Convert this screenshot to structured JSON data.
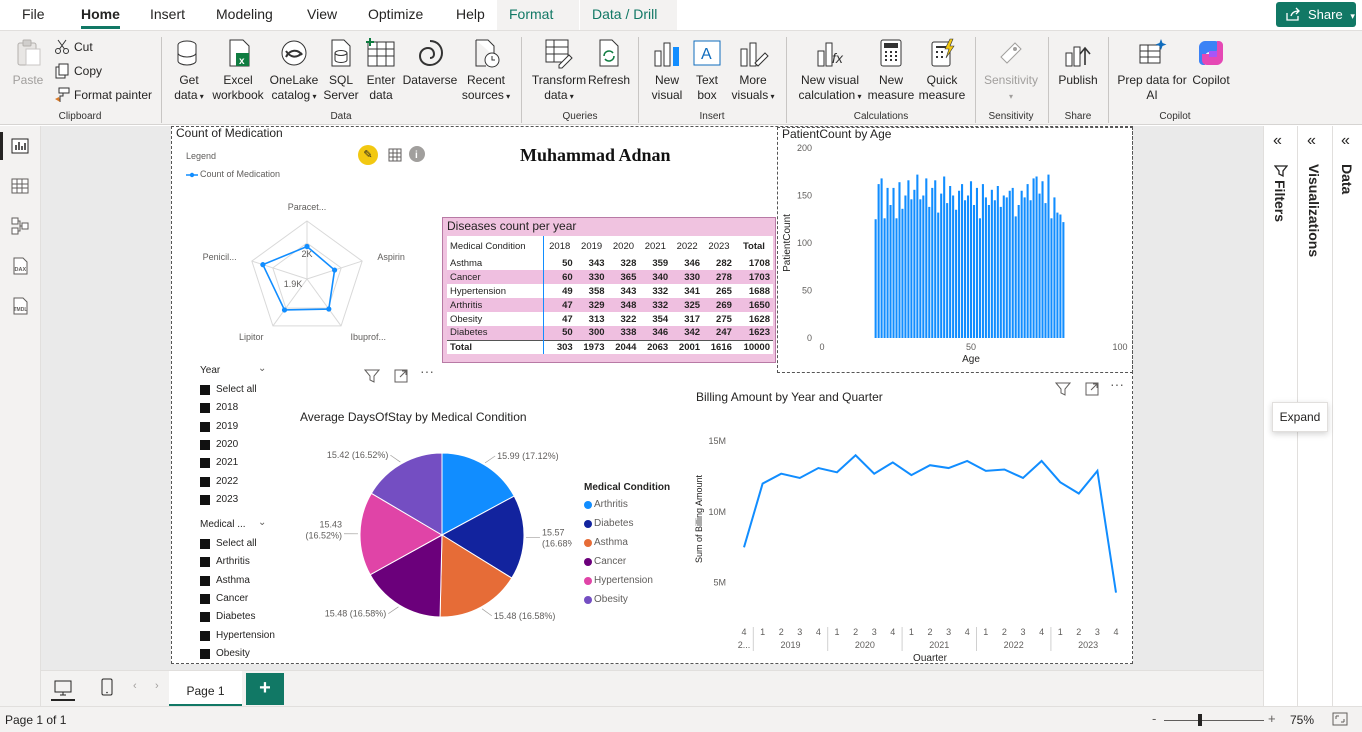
{
  "menu": {
    "tabs": [
      "File",
      "Home",
      "Insert",
      "Modeling",
      "View",
      "Optimize",
      "Help",
      "Format",
      "Data / Drill"
    ],
    "active": "Home",
    "share": "Share"
  },
  "ribbon": {
    "clipboard": {
      "paste": "Paste",
      "cut": "Cut",
      "copy": "Copy",
      "format_painter": "Format painter",
      "label": "Clipboard"
    },
    "data": {
      "get_data": [
        "Get",
        "data"
      ],
      "excel": [
        "Excel",
        "workbook"
      ],
      "onelake": [
        "OneLake",
        "catalog"
      ],
      "sql": [
        "SQL",
        "Server"
      ],
      "enter": [
        "Enter",
        "data"
      ],
      "dataverse": "Dataverse",
      "recent": [
        "Recent",
        "sources"
      ],
      "label": "Data"
    },
    "queries": {
      "transform": [
        "Transform",
        "data"
      ],
      "refresh": "Refresh",
      "label": "Queries"
    },
    "insert": {
      "new_visual": [
        "New",
        "visual"
      ],
      "text_box": [
        "Text",
        "box"
      ],
      "more_visuals": [
        "More",
        "visuals"
      ],
      "label": "Insert"
    },
    "calculations": {
      "visual_calc": [
        "New visual",
        "calculation"
      ],
      "new_measure": [
        "New",
        "measure"
      ],
      "quick_measure": [
        "Quick",
        "measure"
      ],
      "label": "Calculations"
    },
    "sensitivity": {
      "btn": "Sensitivity",
      "label": "Sensitivity"
    },
    "share": {
      "publish": "Publish",
      "label": "Share"
    },
    "copilot": {
      "prep": [
        "Prep data for",
        "AI"
      ],
      "copilot": "Copilot",
      "label": "Copilot"
    }
  },
  "report": {
    "title_text": "Muhammad Adnan",
    "radar": {
      "title": "Count of Medication",
      "legend_title": "Legend",
      "legend_item": "Count of Medication",
      "axes": [
        "Paracet...",
        "Aspirin",
        "Ibuprof...",
        "Lipitor",
        "Penicil..."
      ],
      "ring_labels": [
        "2K",
        "1.9K"
      ],
      "accent": "#118DFF"
    },
    "table": {
      "title": "Diseases count per year",
      "headers": [
        "Medical Condition",
        "2018",
        "2019",
        "2020",
        "2021",
        "2022",
        "2023",
        "Total"
      ],
      "rows": [
        [
          "Asthma",
          "50",
          "343",
          "328",
          "359",
          "346",
          "282",
          "1708"
        ],
        [
          "Cancer",
          "60",
          "330",
          "365",
          "340",
          "330",
          "278",
          "1703"
        ],
        [
          "Hypertension",
          "49",
          "358",
          "343",
          "332",
          "341",
          "265",
          "1688"
        ],
        [
          "Arthritis",
          "47",
          "329",
          "348",
          "332",
          "325",
          "269",
          "1650"
        ],
        [
          "Obesity",
          "47",
          "313",
          "322",
          "354",
          "317",
          "275",
          "1628"
        ],
        [
          "Diabetes",
          "50",
          "300",
          "338",
          "346",
          "342",
          "247",
          "1623"
        ]
      ],
      "total": [
        "Total",
        "303",
        "1973",
        "2044",
        "2063",
        "2001",
        "1616",
        "10000"
      ]
    },
    "slicer_year": {
      "title": "Year",
      "items": [
        "Select all",
        "2018",
        "2019",
        "2020",
        "2021",
        "2022",
        "2023"
      ]
    },
    "slicer_condition": {
      "title": "Medical ...",
      "items": [
        "Select all",
        "Arthritis",
        "Asthma",
        "Cancer",
        "Diabetes",
        "Hypertension",
        "Obesity"
      ]
    },
    "pie_title": "Average DaysOfStay by Medical Condition",
    "pie_legend_title": "Medical Condition",
    "billing_title": "Billing Amount by Year and Quarter",
    "patient_title": "PatientCount by Age",
    "expand_tooltip": "Expand"
  },
  "chart_data": [
    {
      "type": "radar",
      "title": "Count of Medication",
      "categories": [
        "Paracet...",
        "Aspirin",
        "Ibuprof...",
        "Lipitor",
        "Penicil..."
      ],
      "values": [
        1990,
        1975,
        2010,
        2015,
        2050
      ]
    },
    {
      "type": "pie",
      "title": "Average DaysOfStay by Medical Condition",
      "categories": [
        "Arthritis",
        "Diabetes",
        "Asthma",
        "Cancer",
        "Hypertension",
        "Obesity"
      ],
      "values": [
        15.99,
        15.57,
        15.48,
        15.48,
        15.43,
        15.42
      ],
      "labels": [
        "15.99 (17.12%)",
        "15.57 (16.68%)",
        "15.48 (16.58%)",
        "15.48 (16.58%)",
        "15.43 (16.52%)",
        "15.42 (16.52%)"
      ],
      "colors": [
        "#118DFF",
        "#12239E",
        "#E66C37",
        "#6B007B",
        "#E044A7",
        "#744EC2"
      ]
    },
    {
      "type": "line",
      "title": "Billing Amount by Year and Quarter",
      "xlabel": "Quarter",
      "ylabel": "Sum of Billing Amount",
      "y_ticks": [
        "5M",
        "10M",
        "15M"
      ],
      "ylim": [
        3000000,
        16000000
      ],
      "x_quarters": [
        "4",
        "1",
        "2",
        "3",
        "4",
        "1",
        "2",
        "3",
        "4",
        "1",
        "2",
        "3",
        "4",
        "1",
        "2",
        "3",
        "4",
        "1",
        "2",
        "3",
        "4",
        "1",
        "2",
        "3",
        "4"
      ],
      "x_years": [
        "2...",
        "2019",
        "2020",
        "2021",
        "2022",
        "2023"
      ],
      "values": [
        7500000,
        12000000,
        12700000,
        12400000,
        13100000,
        12800000,
        14000000,
        12700000,
        13500000,
        12600000,
        13300000,
        13100000,
        13600000,
        12900000,
        13000000,
        12400000,
        13600000,
        12100000,
        11300000,
        12900000,
        4300000
      ],
      "color": "#118DFF"
    },
    {
      "type": "bar",
      "title": "PatientCount by Age",
      "xlabel": "Age",
      "ylabel": "PatientCount",
      "x_ticks": [
        "0",
        "50",
        "100"
      ],
      "y_ticks": [
        "0",
        "50",
        "100",
        "150",
        "200"
      ],
      "xlim": [
        0,
        100
      ],
      "ylim": [
        0,
        200
      ],
      "ages_start": 18,
      "values": [
        125,
        162,
        168,
        126,
        158,
        140,
        158,
        126,
        164,
        136,
        150,
        166,
        146,
        156,
        172,
        146,
        150,
        168,
        138,
        158,
        166,
        132,
        152,
        170,
        142,
        160,
        150,
        135,
        155,
        162,
        145,
        150,
        165,
        140,
        158,
        126,
        162,
        148,
        140,
        156,
        145,
        160,
        138,
        150,
        148,
        155,
        158,
        128,
        140,
        155,
        148,
        162,
        145,
        168,
        170,
        152,
        165,
        142,
        172,
        126,
        148,
        132,
        130,
        122
      ],
      "color": "#118DFF"
    }
  ],
  "bottom": {
    "page_tab": "Page 1",
    "add": "+"
  },
  "status": {
    "page": "Page 1 of 1",
    "zoom": "75%"
  },
  "panes": {
    "filters": "Filters",
    "visualizations": "Visualizations",
    "data": "Data"
  }
}
